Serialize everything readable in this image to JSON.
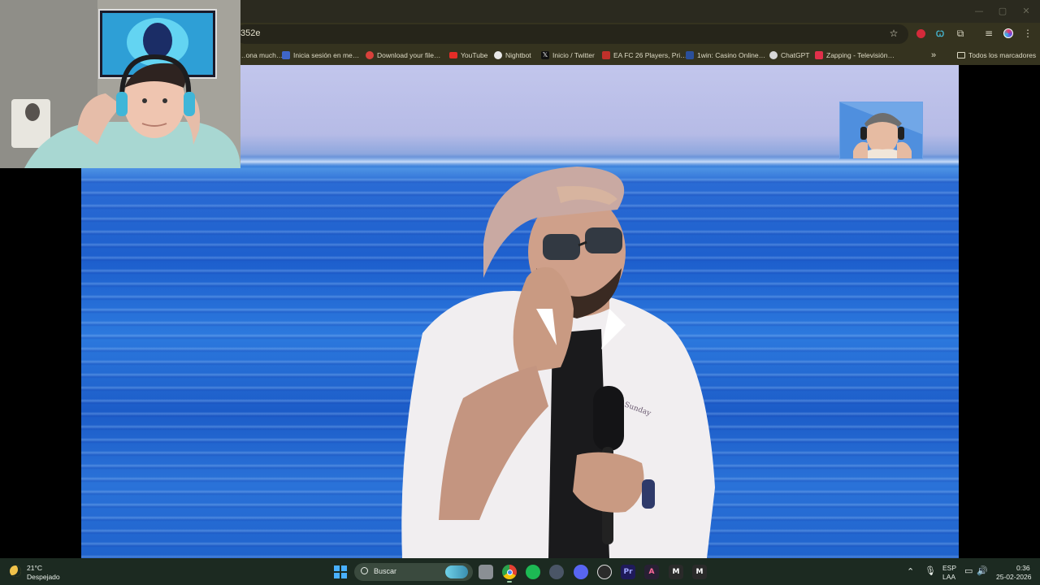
{
  "browser": {
    "url_fragment": "352e",
    "bookmarks": [
      {
        "label": "…ona much…",
        "icon": "web-icon",
        "color": "#8c8a70"
      },
      {
        "label": "Inicia sesión en me…",
        "icon": "ea-sports-icon",
        "color": "#3f66c8"
      },
      {
        "label": "Download your file…",
        "icon": "download-site-icon",
        "color": "#d9413b"
      },
      {
        "label": "YouTube",
        "icon": "youtube-icon",
        "color": "#e52d27"
      },
      {
        "label": "Nightbot",
        "icon": "nightbot-icon",
        "color": "#e8e8e8"
      },
      {
        "label": "Inicio / Twitter",
        "icon": "x-icon",
        "color": "#111111"
      },
      {
        "label": "EA FC 26 Players, Pri…",
        "icon": "futbin-icon",
        "color": "#c0302a"
      },
      {
        "label": "1win: Casino Online…",
        "icon": "1win-icon",
        "color": "#2a4f9a"
      },
      {
        "label": "ChatGPT",
        "icon": "chatgpt-icon",
        "color": "#d7d7d7"
      },
      {
        "label": "Zapping - Televisión…",
        "icon": "zapping-icon",
        "color": "#e0304a"
      }
    ],
    "overflow_label": "»",
    "all_bookmarks_label": "Todos los marcadores"
  },
  "taskbar": {
    "weather_temp": "21°C",
    "weather_desc": "Despejado",
    "search_label": "Buscar",
    "lang_top": "ESP",
    "lang_bottom": "LAA",
    "time": "0:36",
    "date": "25-02-2026",
    "apps": [
      {
        "name": "windows-start-icon",
        "glyph": "",
        "color": "#3aa0ff"
      },
      {
        "name": "file-explorer-icon",
        "glyph": "",
        "color": "#8a8f94"
      },
      {
        "name": "chrome-icon",
        "glyph": "",
        "color": "#e8b52c"
      },
      {
        "name": "spotify-icon",
        "glyph": "",
        "color": "#1db954"
      },
      {
        "name": "media-app-icon",
        "glyph": "",
        "color": "#4a5566"
      },
      {
        "name": "discord-icon",
        "glyph": "",
        "color": "#5865f2"
      },
      {
        "name": "obs-icon",
        "glyph": "",
        "color": "#2b2b2b"
      },
      {
        "name": "premiere-pro-icon",
        "glyph": "Pr",
        "color": "#1f1a5a"
      },
      {
        "name": "affinity-icon",
        "glyph": "A",
        "color": "#282034"
      },
      {
        "name": "app-m-icon",
        "glyph": "M",
        "color": "#2a2a2a"
      },
      {
        "name": "app-m2-icon",
        "glyph": "M",
        "color": "#2a2a2a"
      }
    ]
  },
  "colors": {
    "chrome_bg": "#35331f",
    "taskbar_bg": "#1c2a21",
    "video_sky": "#c2c6ec",
    "video_sea": "#1f62cc"
  }
}
